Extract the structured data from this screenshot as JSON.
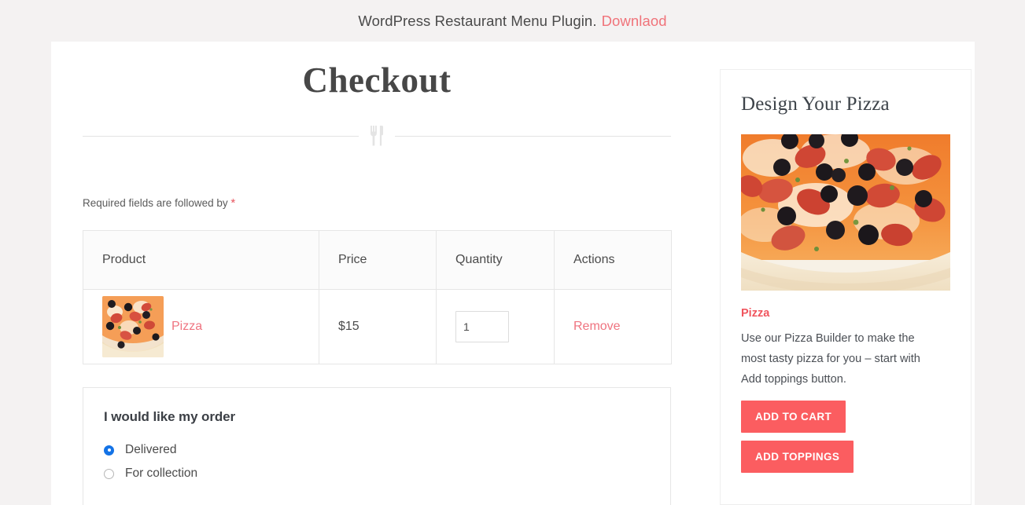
{
  "banner": {
    "text": "WordPress Restaurant Menu Plugin.",
    "link_label": "Downlaod"
  },
  "checkout": {
    "title": "Checkout",
    "divider_icon": "fork-and-knife-icon",
    "required_note": "Required fields are followed by",
    "required_star": "*",
    "table": {
      "headers": [
        "Product",
        "Price",
        "Quantity",
        "Actions"
      ],
      "rows": [
        {
          "product_image": "pizza-thumbnail",
          "product_name": "Pizza",
          "price": "$15",
          "quantity": "1",
          "quantity_placeholder": "1",
          "action_label": "Remove"
        }
      ]
    },
    "order_options": {
      "heading": "I would like my order",
      "options": [
        {
          "label": "Delivered",
          "selected": true
        },
        {
          "label": "For collection",
          "selected": false
        }
      ]
    }
  },
  "sidebar": {
    "title": "Design Your Pizza",
    "image": "pizza-photo",
    "product_name": "Pizza",
    "description": "Use our Pizza Builder to make the most tasty pizza for you – start with Add toppings button.",
    "buttons": {
      "add_to_cart": "ADD TO CART",
      "add_toppings": "ADD TOPPINGS"
    }
  },
  "colors": {
    "accent": "#fb5d60",
    "link": "#ef7480",
    "radio_selected": "#1473e6",
    "page_background": "#f4f2f2"
  }
}
